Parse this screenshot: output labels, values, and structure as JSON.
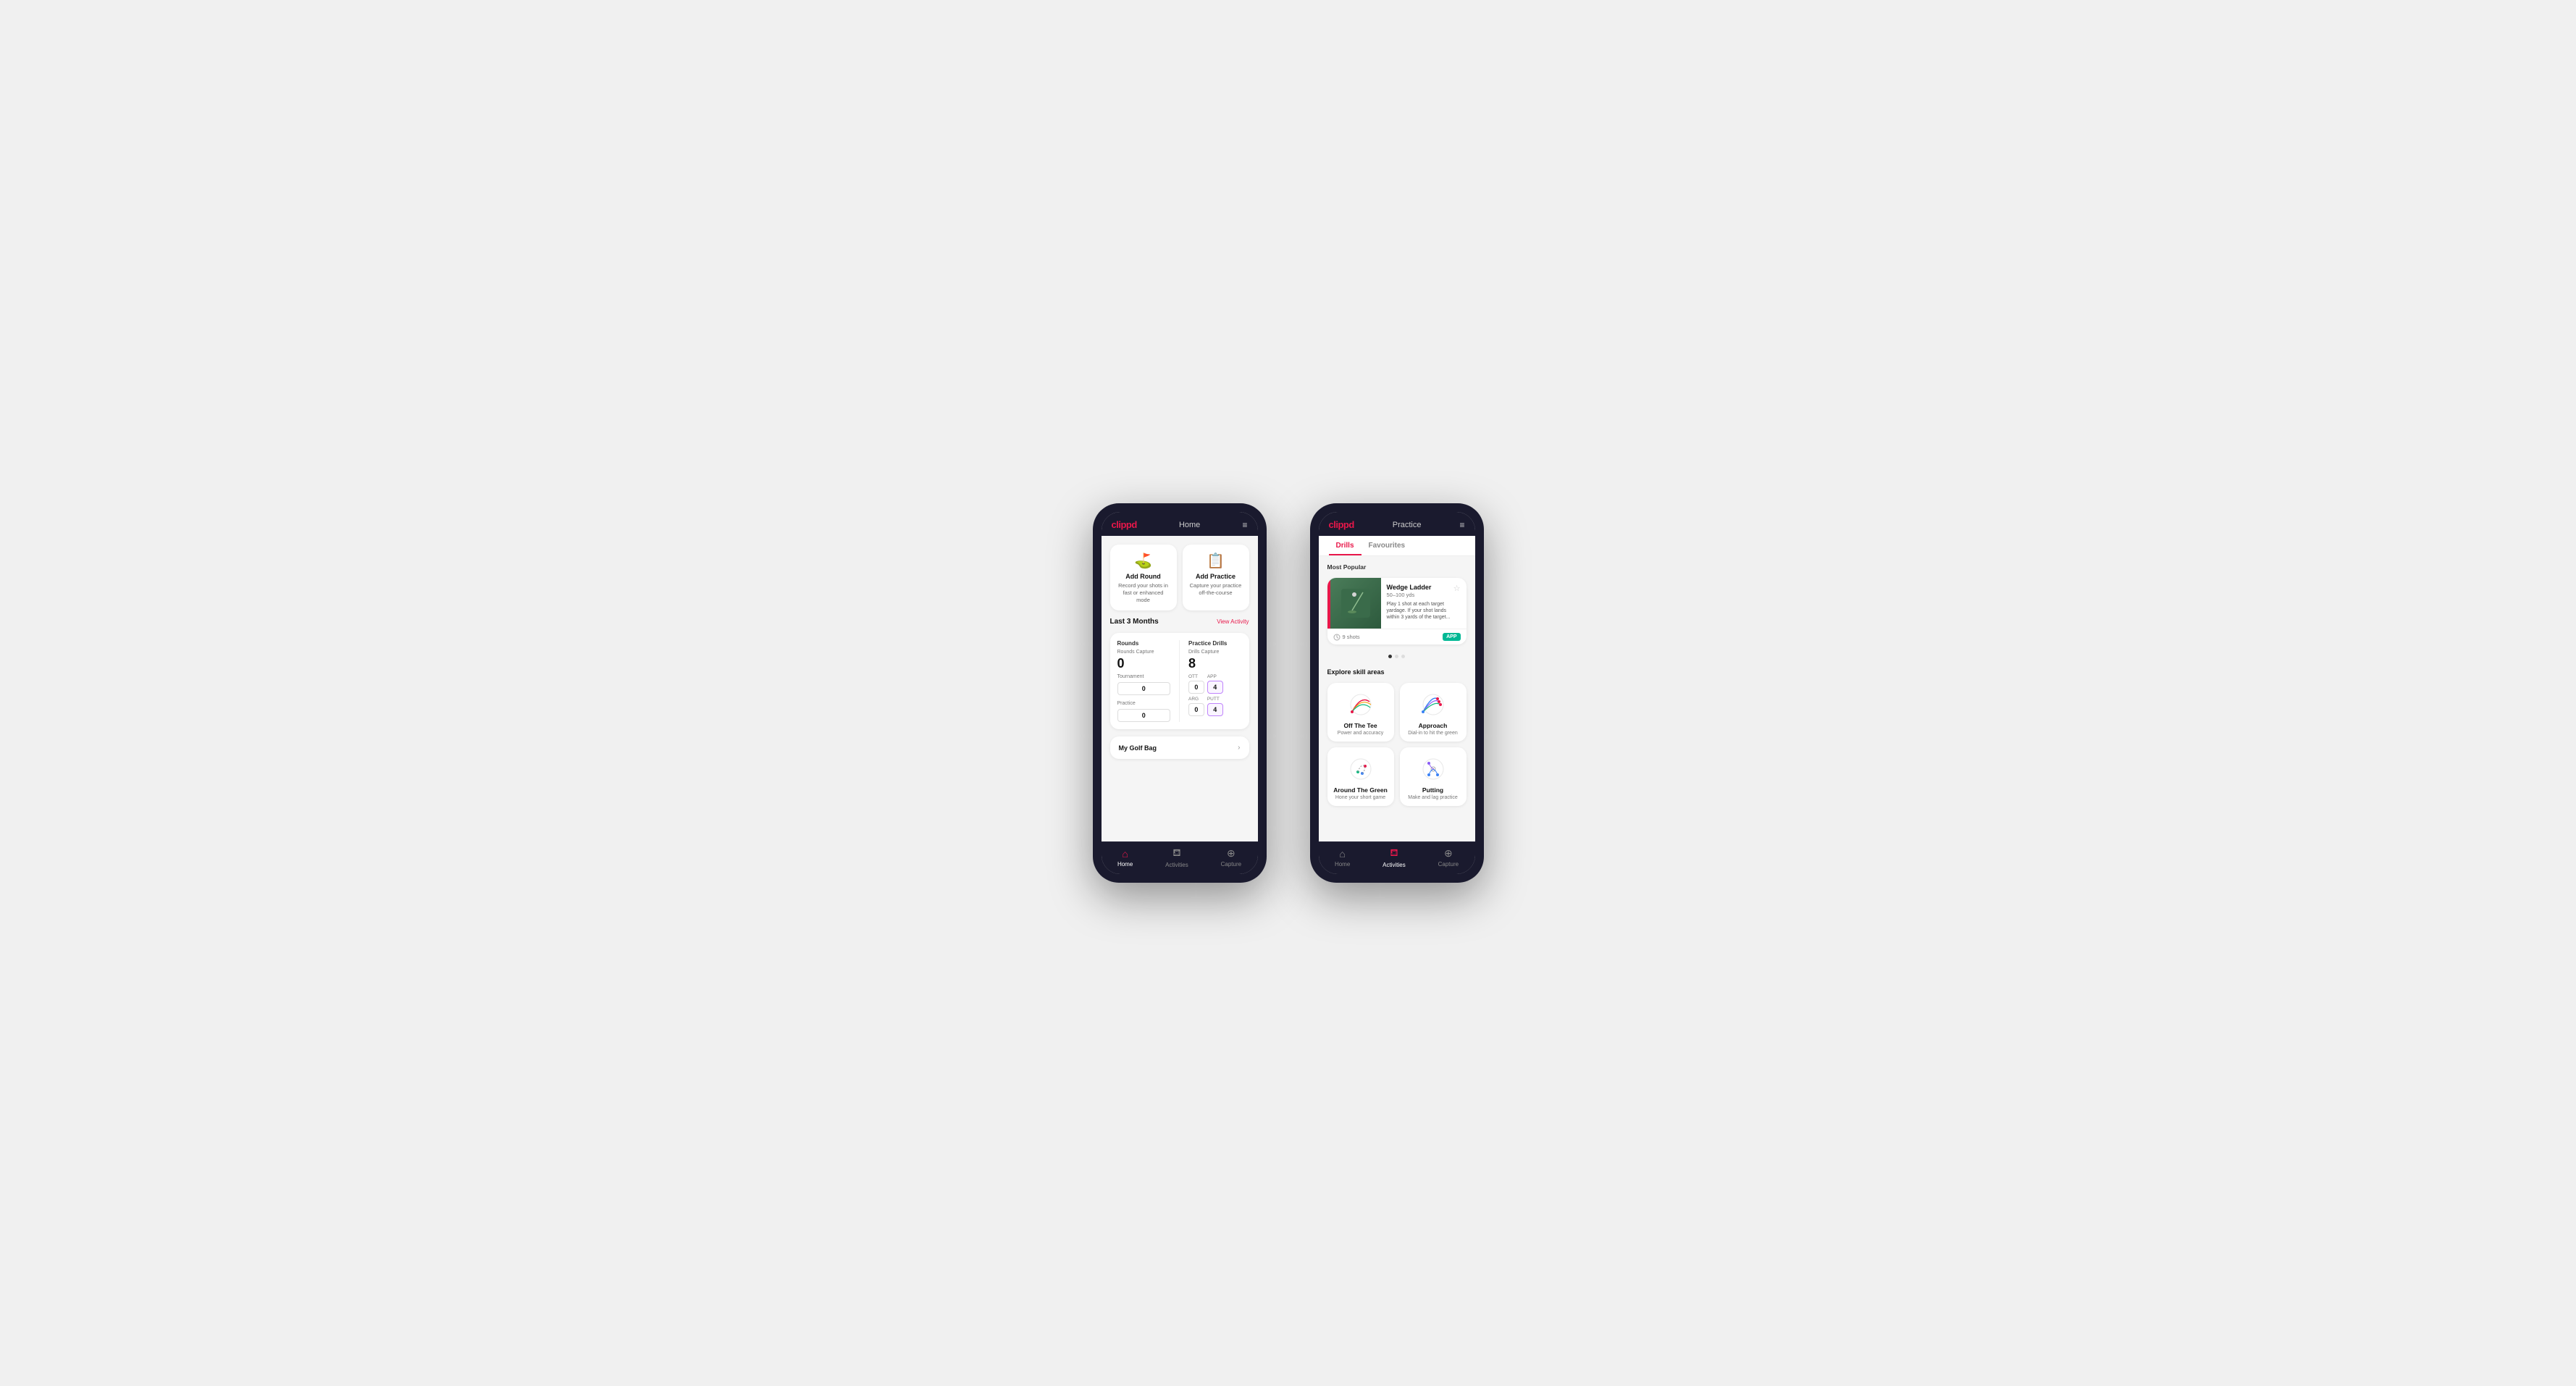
{
  "phone1": {
    "logo": "clippd",
    "page_title": "Home",
    "top_bar_menu": "≡",
    "cards": [
      {
        "icon": "⛳",
        "title": "Add Round",
        "subtitle": "Record your shots in fast or enhanced mode"
      },
      {
        "icon": "📋",
        "title": "Add Practice",
        "subtitle": "Capture your practice off-the-course"
      }
    ],
    "activity_section": {
      "title": "Last 3 Months",
      "link": "View Activity"
    },
    "rounds": {
      "title": "Rounds",
      "capture_label": "Rounds Capture",
      "big_number": "0",
      "tournament_label": "Tournament",
      "tournament_value": "0",
      "practice_label": "Practice",
      "practice_value": "0"
    },
    "practice_drills": {
      "title": "Practice Drills",
      "capture_label": "Drills Capture",
      "big_number": "8",
      "ott_label": "OTT",
      "ott_value": "0",
      "app_label": "APP",
      "app_value": "4",
      "arg_label": "ARG",
      "arg_value": "0",
      "putt_label": "PUTT",
      "putt_value": "4"
    },
    "golf_bag": {
      "label": "My Golf Bag",
      "chevron": "›"
    },
    "nav": [
      {
        "icon": "🏠",
        "label": "Home",
        "active": true
      },
      {
        "icon": "♟",
        "label": "Activities",
        "active": false
      },
      {
        "icon": "⊕",
        "label": "Capture",
        "active": false
      }
    ]
  },
  "phone2": {
    "logo": "clippd",
    "page_title": "Practice",
    "top_bar_menu": "≡",
    "tabs": [
      {
        "label": "Drills",
        "active": true
      },
      {
        "label": "Favourites",
        "active": false
      }
    ],
    "most_popular_label": "Most Popular",
    "featured_drill": {
      "title": "Wedge Ladder",
      "subtitle": "50–100 yds",
      "description": "Play 1 shot at each target yardage. If your shot lands within 3 yards of the target...",
      "shots": "9 shots",
      "badge": "APP"
    },
    "explore_label": "Explore skill areas",
    "skills": [
      {
        "title": "Off The Tee",
        "subtitle": "Power and accuracy",
        "icon_type": "ott"
      },
      {
        "title": "Approach",
        "subtitle": "Dial-in to hit the green",
        "icon_type": "approach"
      },
      {
        "title": "Around The Green",
        "subtitle": "Hone your short game",
        "icon_type": "atg"
      },
      {
        "title": "Putting",
        "subtitle": "Make and lag practice",
        "icon_type": "putting"
      }
    ],
    "nav": [
      {
        "icon": "🏠",
        "label": "Home",
        "active": false
      },
      {
        "icon": "♟",
        "label": "Activities",
        "active": true
      },
      {
        "icon": "⊕",
        "label": "Capture",
        "active": false
      }
    ]
  }
}
